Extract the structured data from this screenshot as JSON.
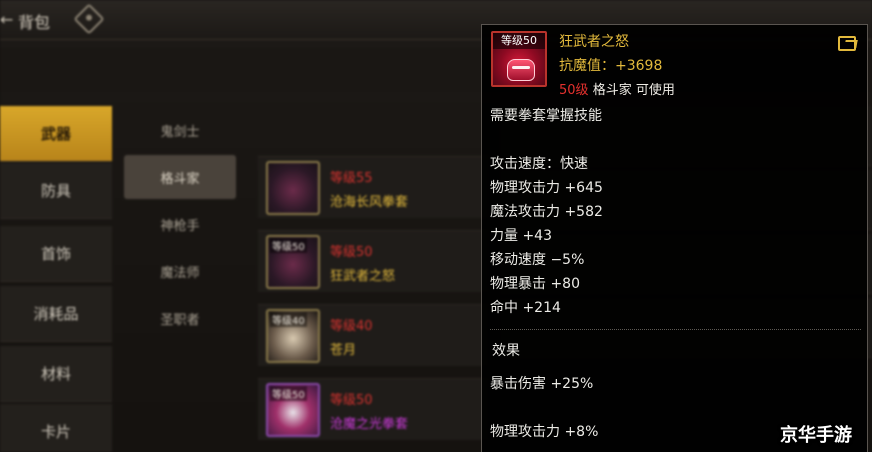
{
  "topbar": {
    "back_glyph": "←",
    "title": "背包",
    "icon": "diamond-menu-icon"
  },
  "categories": [
    {
      "label": "武器",
      "active": true
    },
    {
      "label": "防具",
      "active": false
    },
    {
      "label": "首饰",
      "active": false
    },
    {
      "label": "消耗品",
      "active": false
    },
    {
      "label": "材料",
      "active": false
    },
    {
      "label": "卡片",
      "active": false
    }
  ],
  "classes": [
    {
      "label": "鬼剑士",
      "active": false
    },
    {
      "label": "格斗家",
      "active": true
    },
    {
      "label": "神枪手",
      "active": false
    },
    {
      "label": "魔法师",
      "active": false
    },
    {
      "label": "圣职者",
      "active": false
    }
  ],
  "items": [
    {
      "level": "等级55",
      "name": "沧海长风拳套",
      "thumb_level": ""
    },
    {
      "level": "等级50",
      "name": "狂武者之怒",
      "thumb_level": "等级50"
    },
    {
      "level": "等级40",
      "name": "苍月",
      "thumb_level": "等级40"
    },
    {
      "level": "等级50",
      "name": "沧魔之光拳套",
      "thumb_level": "等级50"
    }
  ],
  "tooltip": {
    "icon_level": "等级50",
    "icon": "gauntlet-icon",
    "name": "狂武者之怒",
    "magic_resist": "抗魔值：+3698",
    "req_level": "50级",
    "req_class": "格斗家 可使用",
    "requirement": "需要拳套掌握技能",
    "stats": [
      "攻击速度：快速",
      "物理攻击力 +645",
      "魔法攻击力 +582",
      "力量 +43",
      "移动速度 −5%",
      "物理暴击 +80",
      "命中 +214"
    ],
    "effect_title": "效果",
    "effects": [
      "暴击伤害 +25%",
      "物理攻击力 +8%"
    ],
    "share_icon": "share-icon"
  },
  "watermark": "京华手游",
  "colors": {
    "item_name_gold": "#e2b93c",
    "level_red": "#e5312e",
    "epic_purple": "#c83ad6",
    "active_tab_gold": "#d8a72a"
  }
}
